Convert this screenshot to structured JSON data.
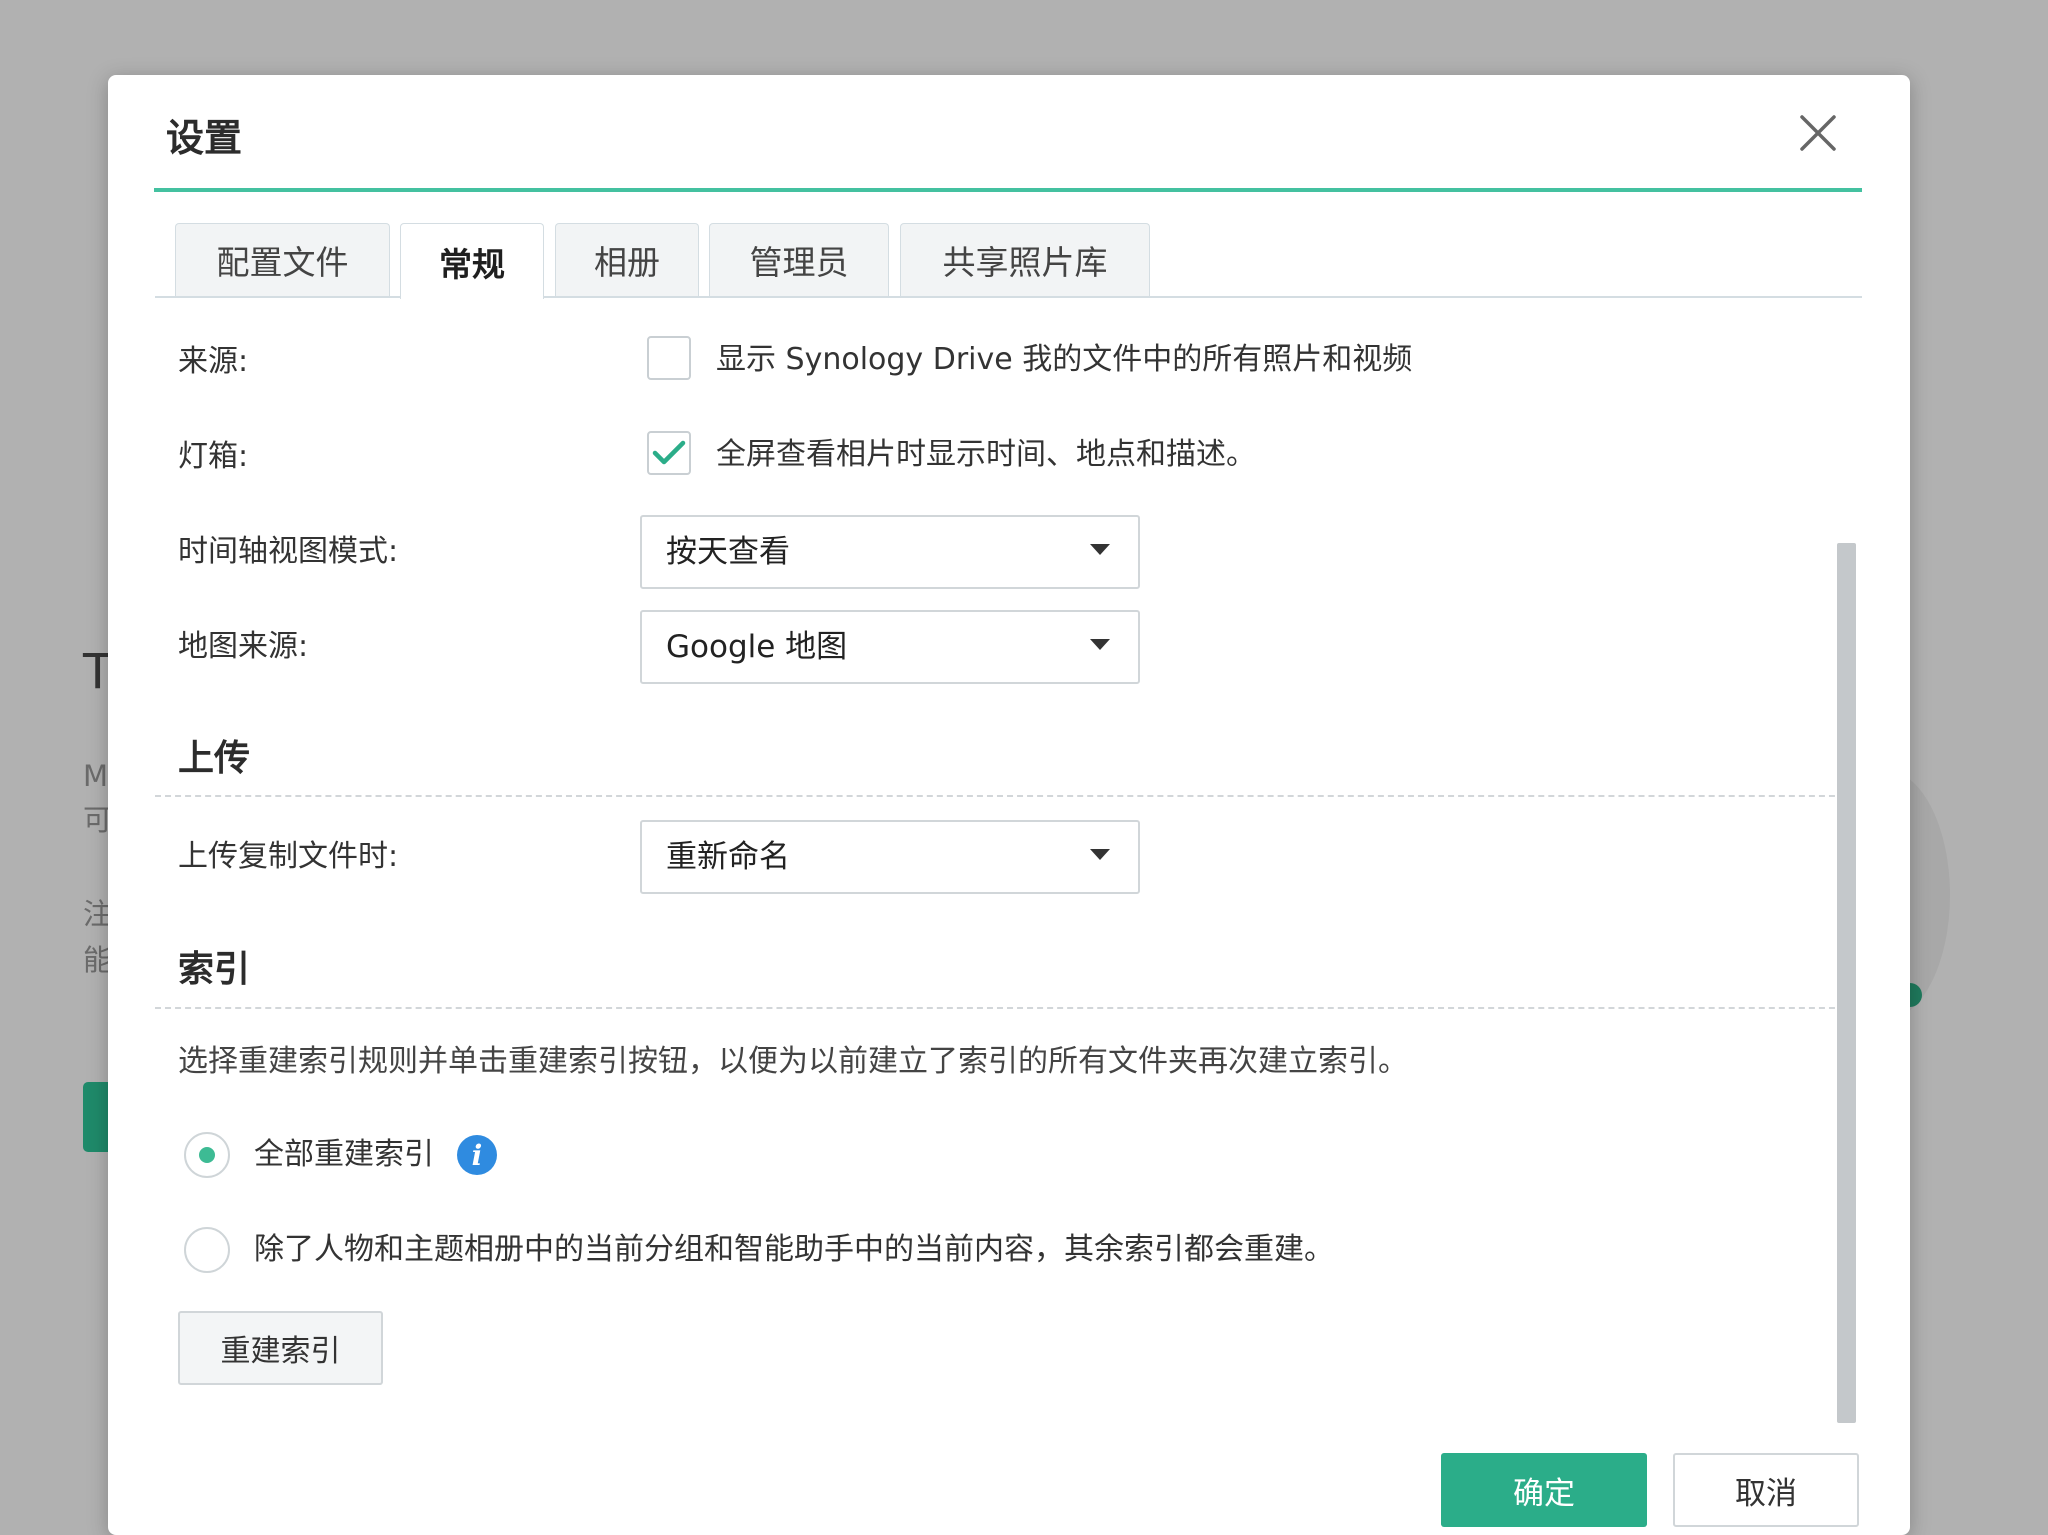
{
  "background": {
    "fragments": [
      "T",
      "M",
      "可",
      "注",
      "能"
    ]
  },
  "dialog": {
    "title": "设置",
    "tabs": [
      {
        "label": "配置文件",
        "active": false
      },
      {
        "label": "常规",
        "active": true
      },
      {
        "label": "相册",
        "active": false
      },
      {
        "label": "管理员",
        "active": false
      },
      {
        "label": "共享照片库",
        "active": false
      }
    ],
    "general": {
      "source": {
        "label": "来源:",
        "checkbox_text": "显示 Synology Drive 我的文件中的所有照片和视频",
        "checked": false
      },
      "lightbox": {
        "label": "灯箱:",
        "checkbox_text": "全屏查看相片时显示时间、地点和描述。",
        "checked": true
      },
      "timeline": {
        "label": "时间轴视图模式:",
        "value": "按天查看"
      },
      "map_source": {
        "label": "地图来源:",
        "value": "Google 地图"
      }
    },
    "upload": {
      "heading": "上传",
      "duplicate": {
        "label": "上传复制文件时:",
        "value": "重新命名"
      }
    },
    "index": {
      "heading": "索引",
      "description": "选择重建索引规则并单击重建索引按钮，以便为以前建立了索引的所有文件夹再次建立索引。",
      "options": [
        {
          "label": "全部重建索引",
          "selected": true
        },
        {
          "label": "除了人物和主题相册中的当前分组和智能助手中的当前内容，其余索引都会重建。",
          "selected": false
        }
      ],
      "rebuild_button": "重建索引"
    },
    "footer": {
      "ok": "确定",
      "cancel": "取消"
    }
  },
  "colors": {
    "accent": "#2bad89",
    "title_line": "#44c1a0",
    "info": "#2f8be0"
  }
}
